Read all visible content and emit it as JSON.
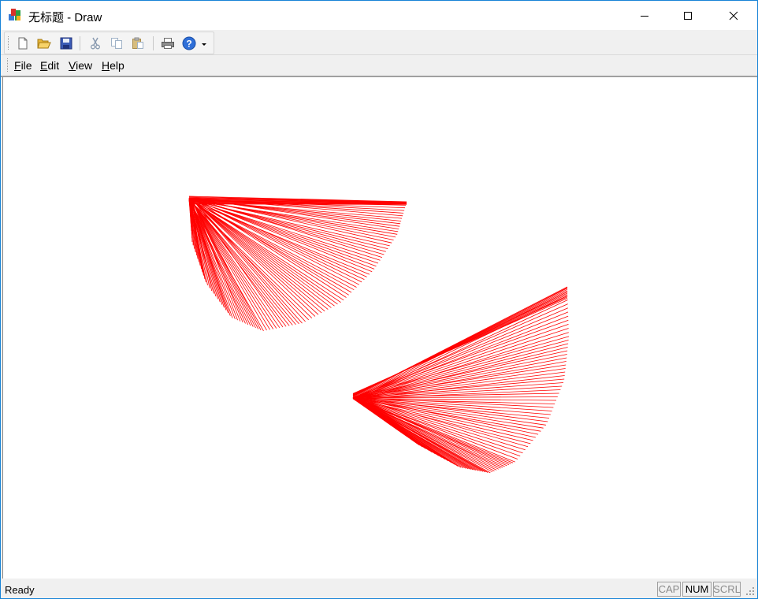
{
  "window": {
    "title": "无标题 - Draw",
    "accent": "#1883d7"
  },
  "toolbar": {
    "buttons": [
      {
        "icon": "new-document-icon"
      },
      {
        "icon": "open-folder-icon"
      },
      {
        "icon": "save-disk-icon"
      },
      {
        "icon": "cut-scissors-icon"
      },
      {
        "icon": "copy-icon"
      },
      {
        "icon": "paste-icon"
      },
      {
        "icon": "print-icon"
      },
      {
        "icon": "help-icon"
      },
      {
        "icon": "dropdown-arrow-icon"
      }
    ]
  },
  "menu": {
    "items": [
      {
        "accel": "F",
        "rest": "ile"
      },
      {
        "accel": "E",
        "rest": "dit"
      },
      {
        "accel": "V",
        "rest": "iew"
      },
      {
        "accel": "H",
        "rest": "elp"
      }
    ]
  },
  "drawing": {
    "stroke_color": "#ff0000",
    "shapes": [
      "fan-upper-left",
      "fan-lower-right"
    ]
  },
  "status": {
    "text": "Ready",
    "indicators": [
      {
        "label": "CAP",
        "active": false
      },
      {
        "label": "NUM",
        "active": true
      },
      {
        "label": "SCRL",
        "active": false
      }
    ]
  }
}
